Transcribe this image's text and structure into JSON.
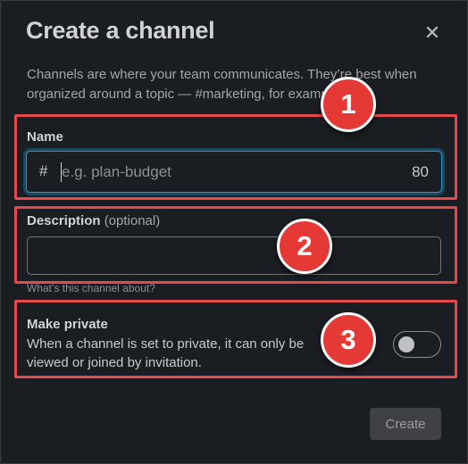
{
  "modal": {
    "title": "Create a channel",
    "close_glyph": "✕",
    "intro_text": "Channels are where your team communicates. They’re best when organized around a topic — #marketing, for example."
  },
  "name_field": {
    "label": "Name",
    "prefix": "#",
    "placeholder": "e.g. plan-budget",
    "char_counter": "80"
  },
  "description_field": {
    "label": "Description",
    "label_suffix": "(optional)",
    "value": "",
    "hint": "What’s this channel about?"
  },
  "private_setting": {
    "title": "Make private",
    "description": "When a channel is set to private, it can only be viewed or joined by invitation.",
    "enabled": false
  },
  "footer": {
    "create_label": "Create"
  },
  "annotations": {
    "badge_1": "1",
    "badge_2": "2",
    "badge_3": "3",
    "callout_color": "#e5484d"
  },
  "colors": {
    "background": "#1a1d21",
    "focus_ring": "#1d9bd1",
    "badge_fill": "#e53935"
  },
  "icons": {
    "close": "close-icon",
    "hash": "hash-icon"
  }
}
